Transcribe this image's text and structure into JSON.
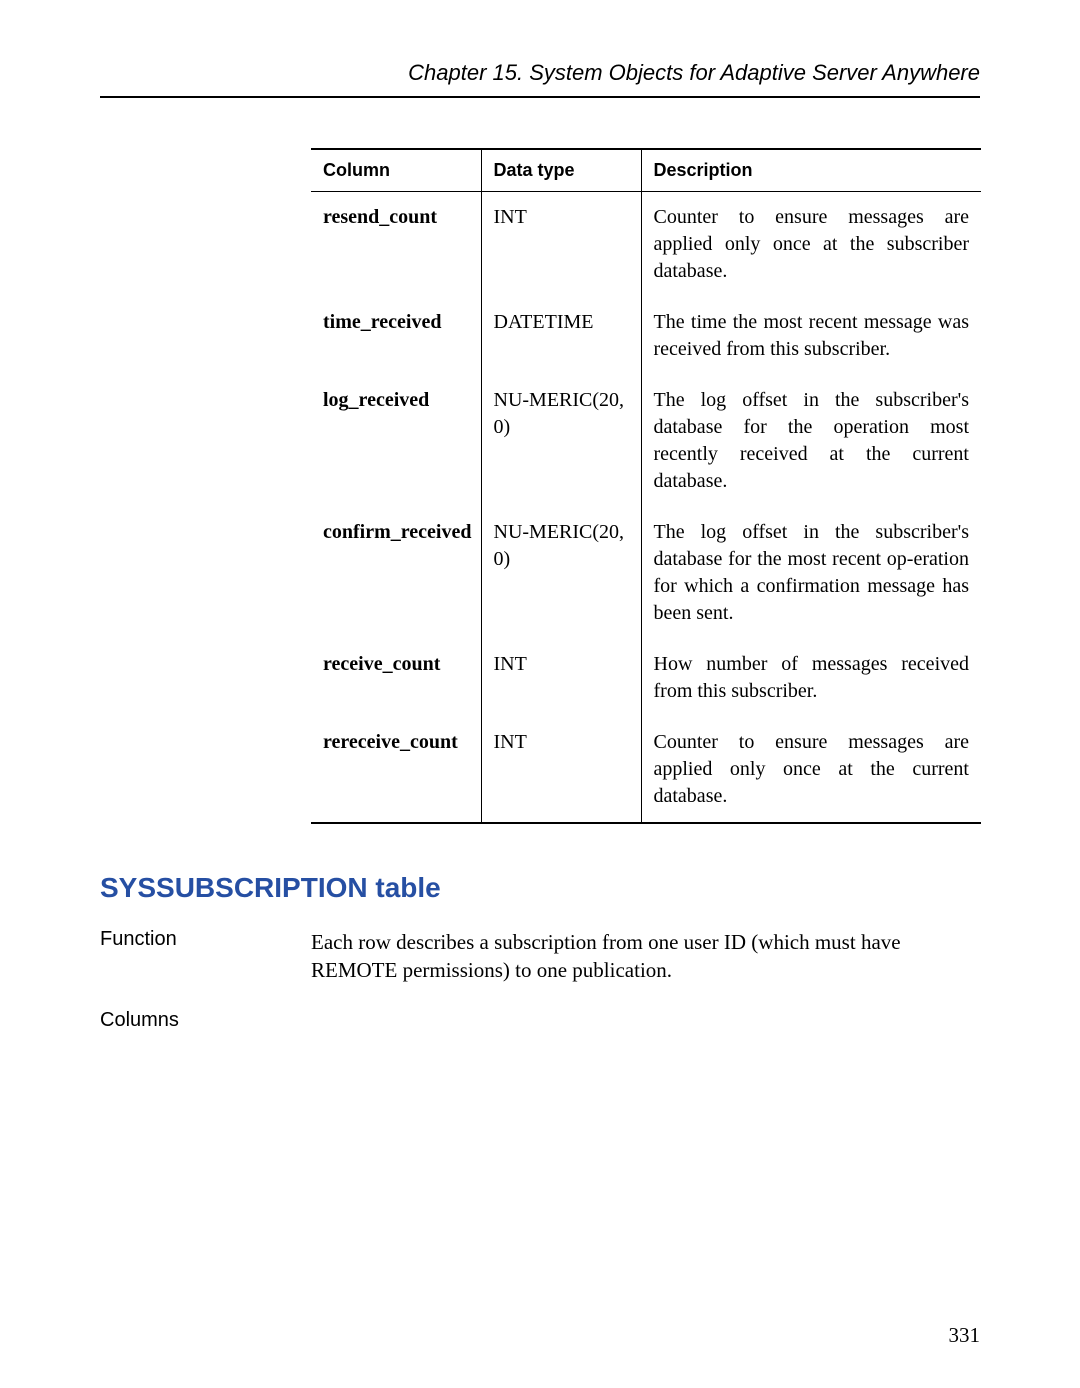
{
  "header": {
    "chapter_title": "Chapter 15.  System Objects for Adaptive Server Anywhere"
  },
  "table": {
    "headers": {
      "col1": "Column",
      "col2": "Data type",
      "col3": "Description"
    },
    "rows": [
      {
        "column": "resend_count",
        "datatype": "INT",
        "description": "Counter to ensure messages are applied only once at the subscriber database."
      },
      {
        "column": "time_received",
        "datatype": "DATETIME",
        "description": "The time the most recent message was received from this subscriber."
      },
      {
        "column": "log_received",
        "datatype": "NU-MERIC(20, 0)",
        "description": "The log offset in the subscriber's database for the operation most recently received at the current database."
      },
      {
        "column": "confirm_received",
        "datatype": "NU-MERIC(20, 0)",
        "description": "The log offset in the subscriber's database for the most recent op-eration for which a confirmation message has been sent."
      },
      {
        "column": "receive_count",
        "datatype": "INT",
        "description": "How number of messages received from this subscriber."
      },
      {
        "column": "rereceive_count",
        "datatype": "INT",
        "description": "Counter to ensure messages are applied only once at the current database."
      }
    ]
  },
  "section": {
    "heading": "SYSSUBSCRIPTION table",
    "function_label": "Function",
    "function_text": "Each row describes a subscription from one user ID (which must have REMOTE permissions) to one publication.",
    "columns_label": "Columns"
  },
  "page_number": "331"
}
